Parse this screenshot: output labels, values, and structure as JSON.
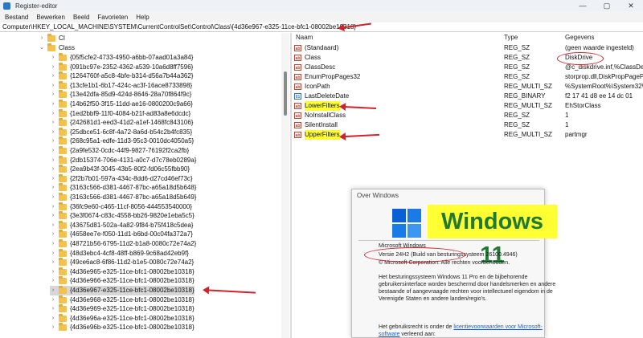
{
  "window": {
    "title": "Register-editor",
    "controls": [
      "—",
      "▢",
      "✕"
    ]
  },
  "menu": [
    "Bestand",
    "Bewerken",
    "Beeld",
    "Favorieten",
    "Help"
  ],
  "address": "Computer\\HKEY_LOCAL_MACHINE\\SYSTEM\\CurrentControlSet\\Control\\Class\\{4d36e967-e325-11ce-bfc1-08002be10318}",
  "tree": {
    "parents": [
      "CI",
      "Class"
    ],
    "items": [
      "{05f5cfe2-4733-4950-a6bb-07aad01a3a84}",
      "{091bc97e-2352-4362-a539-10a6d8ff7596}",
      "{1264760f-a5c8-4bfe-b314-d56a7b44a362}",
      "{13cfe1b1-6b17-424c-ac3f-16ace8733898}",
      "{13e42dfa-85d9-424d-8646-28a70f864f9c}",
      "{14b62f50-3f15-11dd-ae16-0800200c9a66}",
      "{1ed2bbf9-11f0-4084-b21f-ad83a8e6dcdc}",
      "{242681d1-eed3-41d2-a1ef-1468fc843106}",
      "{25dbce51-6c8f-4a72-8a6d-b54c2b4fc835}",
      "{268c95a1-edfe-11d3-95c3-0010dc4050a5}",
      "{2a9fe532-0cdc-44f9-9827-76192f2ca2fb}",
      "{2db15374-706e-4131-a0c7-d7c78eb0289a}",
      "{2ea9b43f-3045-43b5-80f2-fd06c55fbb90}",
      "{2f2b7b01-597a-434c-8dd6-d27cd46ef73c}",
      "{3163c566-d381-4467-87bc-a65a18d5b648}",
      "{3163c566-d381-4467-87bc-a65a18d5b649}",
      "{36fc9e60-c465-11cf-8056-444553540000}",
      "{3e3f0674-c83c-4558-bb26-9820e1eba5c5}",
      "{43675d81-502a-4a82-9f84-b75f418c5dea}",
      "{4658ee7e-f050-11d1-b6bd-00c04fa372a7}",
      "{48721b56-6795-11d2-b1a8-0080c72e74a2}",
      "{48d3ebc4-4cf8-48ff-b869-9c68ad42eb9f}",
      "{49ce6ac8-6f86-11d2-b1e5-0080c72e74a2}",
      "{4d36e965-e325-11ce-bfc1-08002be10318}",
      "{4d36e966-e325-11ce-bfc1-08002be10318}",
      "{4d36e967-e325-11ce-bfc1-08002be10318}",
      "{4d36e968-e325-11ce-bfc1-08002be10318}",
      "{4d36e969-e325-11ce-bfc1-08002be10318}",
      "{4d36e96a-e325-11ce-bfc1-08002be10318}",
      "{4d36e96b-e325-11ce-bfc1-08002be10318}"
    ],
    "selected_index": 25
  },
  "values": {
    "headers": {
      "name": "Naam",
      "type": "Type",
      "data": "Gegevens"
    },
    "rows": [
      {
        "name": "(Standaard)",
        "type": "REG_SZ",
        "data": "(geen waarde ingesteld)",
        "icon": "string-value-icon"
      },
      {
        "name": "Class",
        "type": "REG_SZ",
        "data": "DiskDrive",
        "icon": "string-value-icon"
      },
      {
        "name": "ClassDesc",
        "type": "REG_SZ",
        "data": "@c_diskdrive.inf,%ClassDesc%",
        "icon": "string-value-icon"
      },
      {
        "name": "EnumPropPages32",
        "type": "REG_SZ",
        "data": "storprop.dll,DiskPropPageProvider",
        "icon": "string-value-icon"
      },
      {
        "name": "IconPath",
        "type": "REG_MULTI_SZ",
        "data": "%SystemRoot%\\System32\\setupapi.dll",
        "icon": "string-value-icon"
      },
      {
        "name": "LastDeleteDate",
        "type": "REG_BINARY",
        "data": "f2 17 41 d8 ee 14 dc 01",
        "icon": "binary-value-icon"
      },
      {
        "name": "LowerFilters",
        "type": "REG_MULTI_SZ",
        "data": "EhStorClass",
        "icon": "string-value-icon"
      },
      {
        "name": "NoInstallClass",
        "type": "REG_SZ",
        "data": "1",
        "icon": "string-value-icon"
      },
      {
        "name": "SilentInstall",
        "type": "REG_SZ",
        "data": "1",
        "icon": "string-value-icon"
      },
      {
        "name": "UpperFilters",
        "type": "REG_MULTI_SZ",
        "data": "partmgr",
        "icon": "string-value-icon"
      }
    ]
  },
  "about": {
    "title": "Over Windows",
    "logo_text": "Windows 11",
    "product": "Microsoft Windows",
    "version": "Versie 24H2 (Build van besturingssysteem 26100.4946)",
    "copyright": "© Microsoft Corporation. Alle rechten voorbehouden.",
    "desc_lines": [
      "Het besturingssysteem Windows 11 Pro en de bijbehorende",
      "gebruikersinterface worden beschermd door handelsmerken en andere",
      "bestaande of aangevraagde rechten voor intellectueel eigendom in de",
      "Verenigde Staten en andere landen/regio's."
    ],
    "license_prefix": "Het gebruiksrecht is onder de ",
    "license_link": "licentievoorwaarden voor Microsoft-",
    "license_link2": "software",
    "license_suffix": " verleend aan:"
  },
  "colors": {
    "annotation_red": "#d0232a",
    "highlight_yellow": "#ffff33",
    "logo_green": "#1f7a34"
  }
}
